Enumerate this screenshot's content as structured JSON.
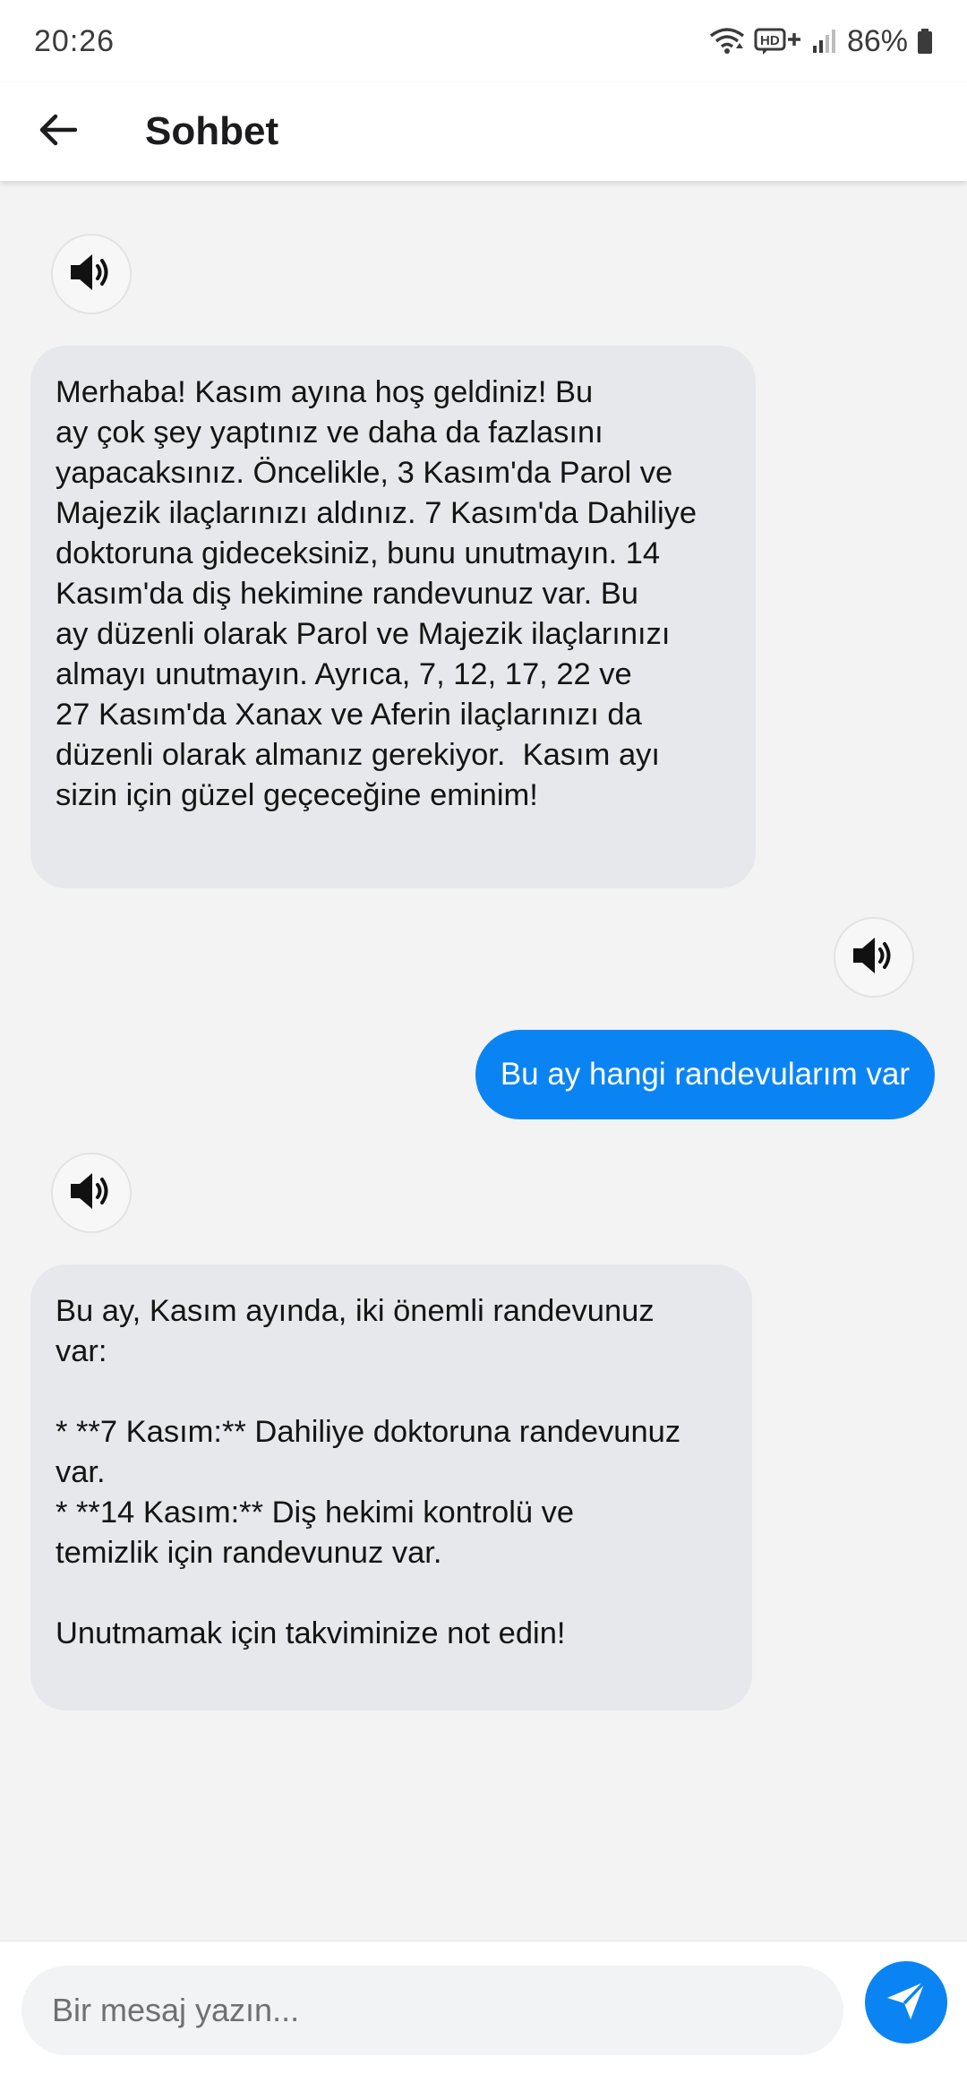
{
  "status_bar": {
    "time": "20:26",
    "battery": "86%",
    "icons": [
      "wifi-icon",
      "hd-plus-icon",
      "signal-icon",
      "battery-icon"
    ]
  },
  "app_bar": {
    "title": "Sohbet",
    "back_icon": "arrow-left-icon"
  },
  "messages": [
    {
      "sender": "bot",
      "text": "Merhaba! Kasım ayına hoş geldiniz! Bu\nay çok şey yaptınız ve daha da fazlasını\nyapacaksınız. Öncelikle, 3 Kasım'da Parol ve\nMajezik ilaçlarınızı aldınız. 7 Kasım'da Dahiliye\ndoktoruna gideceksiniz, bunu unutmayın. 14\nKasım'da diş hekimine randevunuz var. Bu\nay düzenli olarak Parol ve Majezik ilaçlarınızı\nalmayı unutmayın. Ayrıca, 7, 12, 17, 22 ve\n27 Kasım'da Xanax ve Aferin ilaçlarınızı da\ndüzenli olarak almanız gerekiyor.  Kasım ayı\nsizin için güzel geçeceğine eminim!\n"
    },
    {
      "sender": "user",
      "text": "Bu ay hangi randevularım var"
    },
    {
      "sender": "bot",
      "text": "Bu ay, Kasım ayında, iki önemli randevunuz\nvar:\n\n* **7 Kasım:** Dahiliye doktoruna randevunuz\nvar.\n* **14 Kasım:** Diş hekimi kontrolü ve\ntemizlik için randevunuz var.\n\nUnutmamak için takviminize not edin!"
    }
  ],
  "speaker_icon": "speaker-icon",
  "input": {
    "placeholder": "Bir mesaj yazın...",
    "value": ""
  },
  "send_icon": "send-icon",
  "colors": {
    "accent": "#0b84f3",
    "bot_bubble": "#e6e8eb",
    "background": "#f3f3f4"
  }
}
